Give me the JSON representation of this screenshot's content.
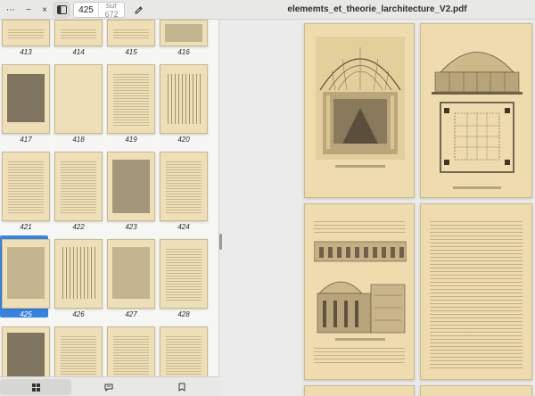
{
  "window": {
    "document_title": "elememts_et_theorie_larchitecture_V2.pdf",
    "menu_glyph": "⋯",
    "minimize_glyph": "−",
    "close_glyph": "×"
  },
  "toolbar": {
    "current_page": "425",
    "page_count_label": "sur 672"
  },
  "sidebar": {
    "thumbnails": [
      {
        "label": "413"
      },
      {
        "label": "414"
      },
      {
        "label": "415"
      },
      {
        "label": "416"
      },
      {
        "label": "417"
      },
      {
        "label": "418"
      },
      {
        "label": "419"
      },
      {
        "label": "420"
      },
      {
        "label": "421"
      },
      {
        "label": "422"
      },
      {
        "label": "423"
      },
      {
        "label": "424"
      },
      {
        "label": "425"
      },
      {
        "label": "426"
      },
      {
        "label": "427"
      },
      {
        "label": "428"
      },
      {
        "label": ""
      },
      {
        "label": ""
      },
      {
        "label": ""
      },
      {
        "label": ""
      }
    ],
    "selected_page": "425"
  },
  "bottom_bar": {
    "buttons": [
      "thumbnails-view",
      "annotations-view",
      "bookmarks-view"
    ],
    "active": "thumbnails-view"
  },
  "colors": {
    "accent": "#3584e4",
    "page_paper": "#eedcae"
  }
}
